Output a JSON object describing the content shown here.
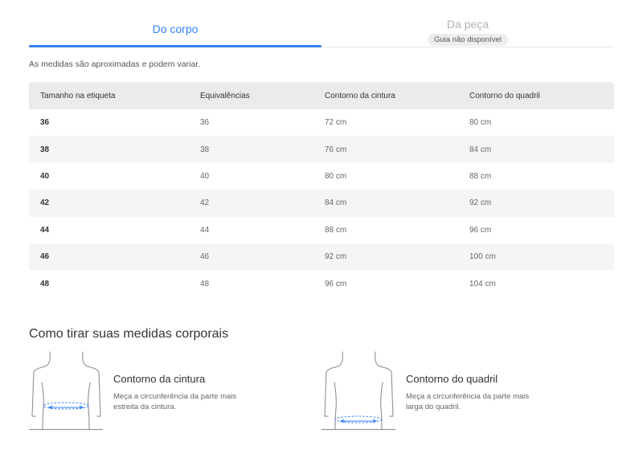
{
  "tabs": [
    {
      "label": "Do corpo",
      "active": true
    },
    {
      "label": "Da peça",
      "badge": "Guia não disponível",
      "active": false
    }
  ],
  "note": "As medidas são aproximadas e podem variar.",
  "table": {
    "headers": [
      "Tamanho na etiqueta",
      "Equivalências",
      "Contorno da cintura",
      "Contorno do quadril"
    ],
    "rows": [
      [
        "36",
        "36",
        "72 cm",
        "80 cm"
      ],
      [
        "38",
        "38",
        "76 cm",
        "84 cm"
      ],
      [
        "40",
        "40",
        "80 cm",
        "88 cm"
      ],
      [
        "42",
        "42",
        "84 cm",
        "92 cm"
      ],
      [
        "44",
        "44",
        "88 cm",
        "96 cm"
      ],
      [
        "46",
        "46",
        "92 cm",
        "100 cm"
      ],
      [
        "48",
        "48",
        "96 cm",
        "104 cm"
      ]
    ]
  },
  "howto": {
    "title": "Como tirar suas medidas corporais",
    "items": [
      {
        "title": "Contorno da cintura",
        "desc": "Meça a circunferência da parte mais estreita da cintura.",
        "icon": "waist-measure-icon"
      },
      {
        "title": "Contorno do quadril",
        "desc": "Meça a circunferência da parte mais larga do quadril.",
        "icon": "hip-measure-icon"
      }
    ]
  },
  "colors": {
    "accent": "#3483fa",
    "header_bg": "#ebebeb",
    "row_alt": "#f5f5f5"
  }
}
